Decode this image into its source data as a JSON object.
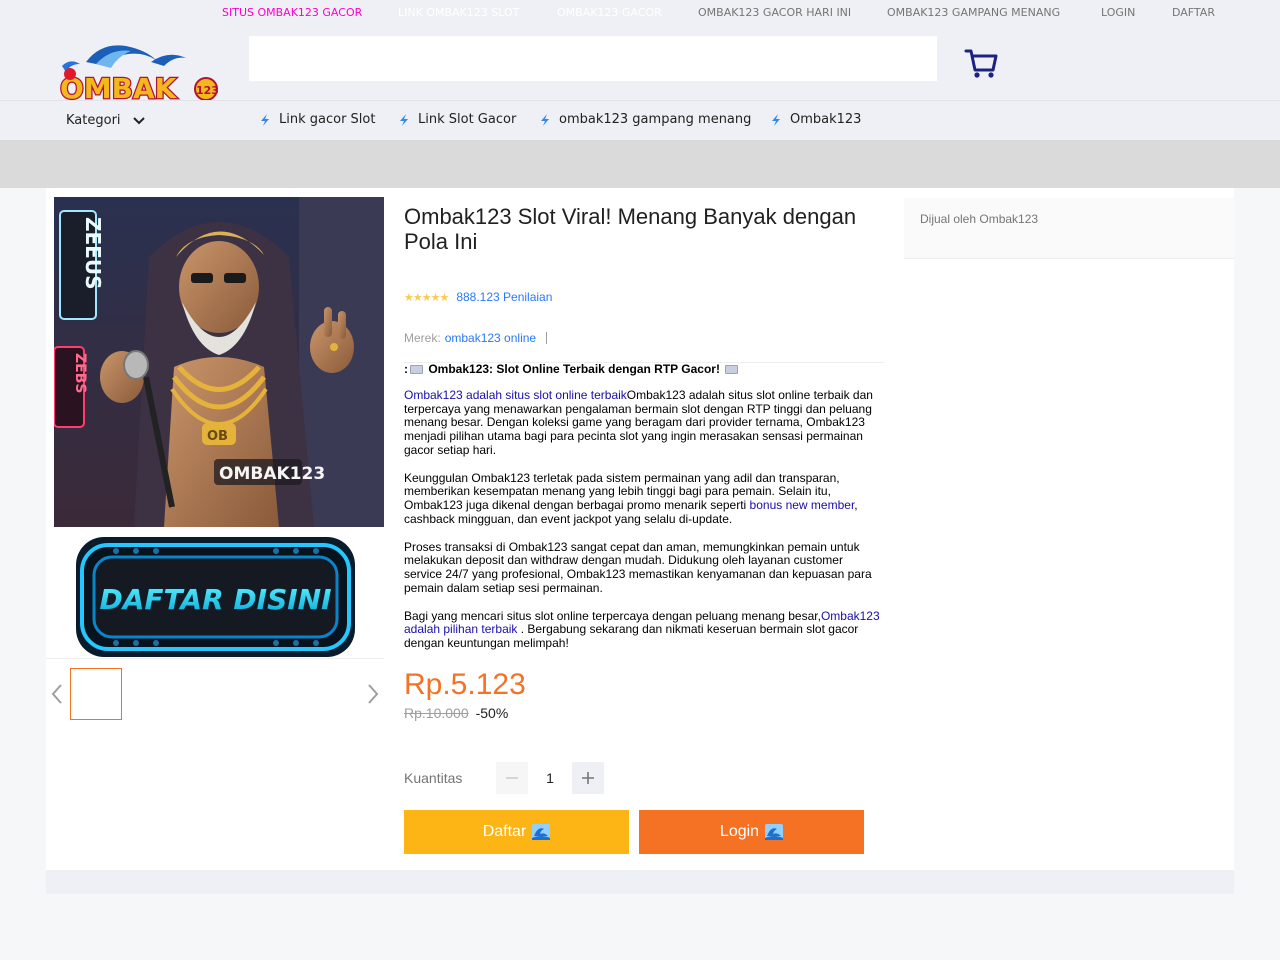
{
  "topbar": {
    "links": [
      {
        "label": "SITUS OMBAK123 GACOR",
        "color": "#ff00c8"
      },
      {
        "label": "LINK OMBAK123 SLOT",
        "color": "#ffffff"
      },
      {
        "label": "OMBAK123 GACOR",
        "color": "#ffffff"
      },
      {
        "label": "OMBAK123 GACOR HARI INI",
        "color": "#757575"
      },
      {
        "label": "OMBAK123 GAMPANG MENANG",
        "color": "#757575"
      },
      {
        "label": "LOGIN",
        "color": "#757575"
      },
      {
        "label": "DAFTAR",
        "color": "#757575"
      }
    ]
  },
  "header": {
    "logo_text": "OMBAK",
    "logo_badge": "123",
    "search": {
      "value": "",
      "placeholder": ""
    },
    "cart_icon": "shopping-cart-icon"
  },
  "nav": {
    "kategori_label": "Kategori",
    "links": [
      {
        "label": "Link gacor Slot",
        "icon": "lightning-bolt-icon"
      },
      {
        "label": "Link Slot Gacor",
        "icon": "lightning-bolt-icon"
      },
      {
        "label": "ombak123 gampang menang",
        "icon": "lightning-bolt-icon"
      },
      {
        "label": "Ombak123",
        "icon": "lightning-bolt-icon"
      }
    ]
  },
  "gallery": {
    "main_image_labels": [
      "ZEEUS",
      "ZEBS",
      "OMBAK123",
      "OB"
    ],
    "daftar_banner_label": "DAFTAR DISINI"
  },
  "product": {
    "title": "Ombak123 Slot Viral! Menang Banyak dengan Pola Ini",
    "rating_stars": 5,
    "rating_count": "888.123 Penilaian",
    "brand_label": "Merek:",
    "brand_value": "ombak123 online",
    "desc_heading_prefix": ":",
    "desc_heading": " Ombak123: Slot Online Terbaik dengan RTP Gacor! ",
    "p1_link": "Ombak123 adalah situs slot online terbaik",
    "p1_text": "Ombak123 adalah situs slot online terbaik dan terpercaya yang menawarkan pengalaman bermain slot dengan RTP tinggi dan peluang menang besar. Dengan koleksi game yang beragam dari provider ternama, Ombak123 menjadi pilihan utama bagi para pecinta slot yang ingin merasakan sensasi permainan gacor setiap hari.",
    "p2_text": "Keunggulan Ombak123 terletak pada sistem permainan yang adil dan transparan, memberikan kesempatan menang yang lebih tinggi bagi para pemain. Selain itu, Ombak123 juga dikenal dengan berbagai promo menarik seperti ",
    "p2_link": "bonus new member",
    "p2_tail": ", cashback mingguan, dan event jackpot yang selalu di-update.",
    "p3_text": "Proses transaksi di Ombak123 sangat cepat dan aman, memungkinkan pemain untuk melakukan deposit dan withdraw dengan mudah. Didukung oleh layanan customer service 24/7 yang profesional, Ombak123 memastikan kenyamanan dan kepuasan para pemain dalam setiap sesi permainan.",
    "p4_text": "Bagi yang mencari situs slot online terpercaya dengan peluang menang besar,",
    "p4_link": "Ombak123 adalah pilihan terbaik",
    "p4_tail": " . Bergabung sekarang dan nikmati keseruan bermain slot gacor dengan keuntungan melimpah!",
    "price": "Rp.5.123",
    "old_price": "Rp.10.000",
    "discount": "-50%",
    "quantity_label": "Kuantitas",
    "quantity_value": "1",
    "btn_daftar": "Daftar",
    "btn_login": "Login"
  },
  "seller": {
    "label": "Dijual oleh Ombak123"
  },
  "colors": {
    "accent_orange": "#f57224",
    "accent_yellow": "#fdb515",
    "link_blue": "#2879fe",
    "desc_link": "#1a0dab"
  }
}
